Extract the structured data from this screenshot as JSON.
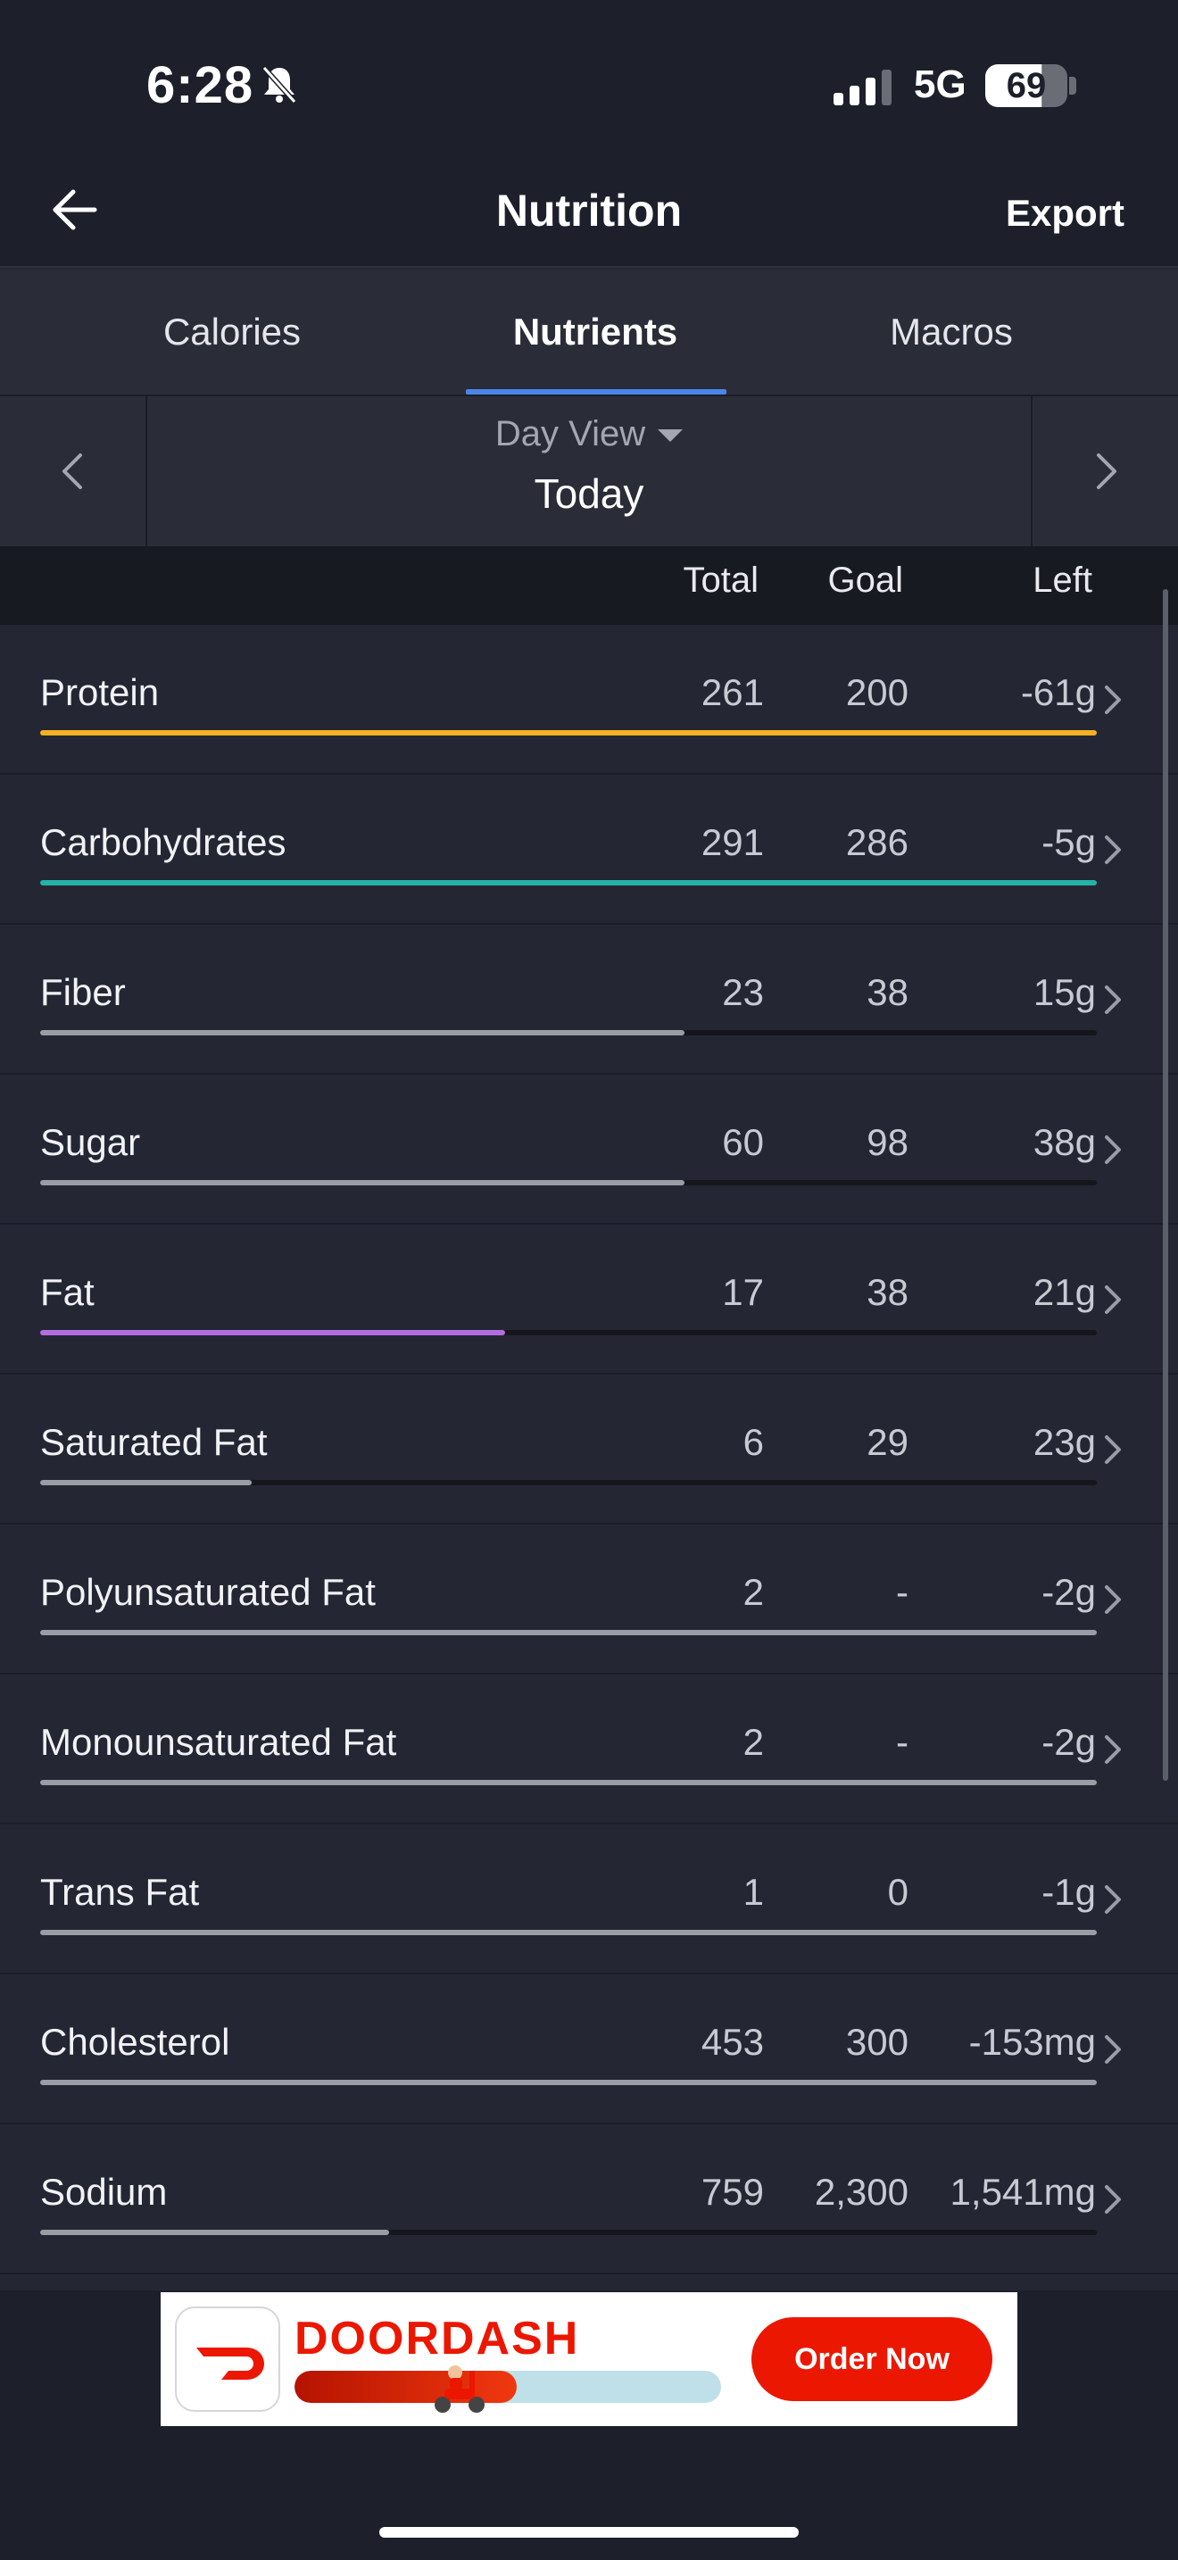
{
  "status": {
    "time": "6:28",
    "network": "5G",
    "battery": "69"
  },
  "header": {
    "title": "Nutrition",
    "export_label": "Export"
  },
  "tabs": [
    {
      "label": "Calories"
    },
    {
      "label": "Nutrients",
      "active": true
    },
    {
      "label": "Macros"
    }
  ],
  "date_nav": {
    "view_label": "Day View",
    "date_label": "Today"
  },
  "columns": {
    "total": "Total",
    "goal": "Goal",
    "left": "Left"
  },
  "nutrients": [
    {
      "name": "Protein",
      "total": "261",
      "goal": "200",
      "left": "-61g",
      "progress": 1.0,
      "color": "#f5b125"
    },
    {
      "name": "Carbohydrates",
      "total": "291",
      "goal": "286",
      "left": "-5g",
      "progress": 1.0,
      "color": "#26b3a7"
    },
    {
      "name": "Fiber",
      "total": "23",
      "goal": "38",
      "left": "15g",
      "progress": 0.61,
      "color": "#9a9da6"
    },
    {
      "name": "Sugar",
      "total": "60",
      "goal": "98",
      "left": "38g",
      "progress": 0.61,
      "color": "#9a9da6"
    },
    {
      "name": "Fat",
      "total": "17",
      "goal": "38",
      "left": "21g",
      "progress": 0.44,
      "color": "#b36de0"
    },
    {
      "name": "Saturated Fat",
      "total": "6",
      "goal": "29",
      "left": "23g",
      "progress": 0.2,
      "color": "#9a9da6"
    },
    {
      "name": "Polyunsaturated Fat",
      "total": "2",
      "goal": "-",
      "left": "-2g",
      "progress": 1.0,
      "color": "#9a9da6"
    },
    {
      "name": "Monounsaturated Fat",
      "total": "2",
      "goal": "-",
      "left": "-2g",
      "progress": 1.0,
      "color": "#9a9da6"
    },
    {
      "name": "Trans Fat",
      "total": "1",
      "goal": "0",
      "left": "-1g",
      "progress": 1.0,
      "color": "#9a9da6"
    },
    {
      "name": "Cholesterol",
      "total": "453",
      "goal": "300",
      "left": "-153mg",
      "progress": 1.0,
      "color": "#9a9da6"
    },
    {
      "name": "Sodium",
      "total": "759",
      "goal": "2,300",
      "left": "1,541mg",
      "progress": 0.33,
      "color": "#9a9da6"
    }
  ],
  "ad": {
    "brand": "DOORDASH",
    "cta": "Order Now",
    "brand_color": "#eb1700"
  }
}
